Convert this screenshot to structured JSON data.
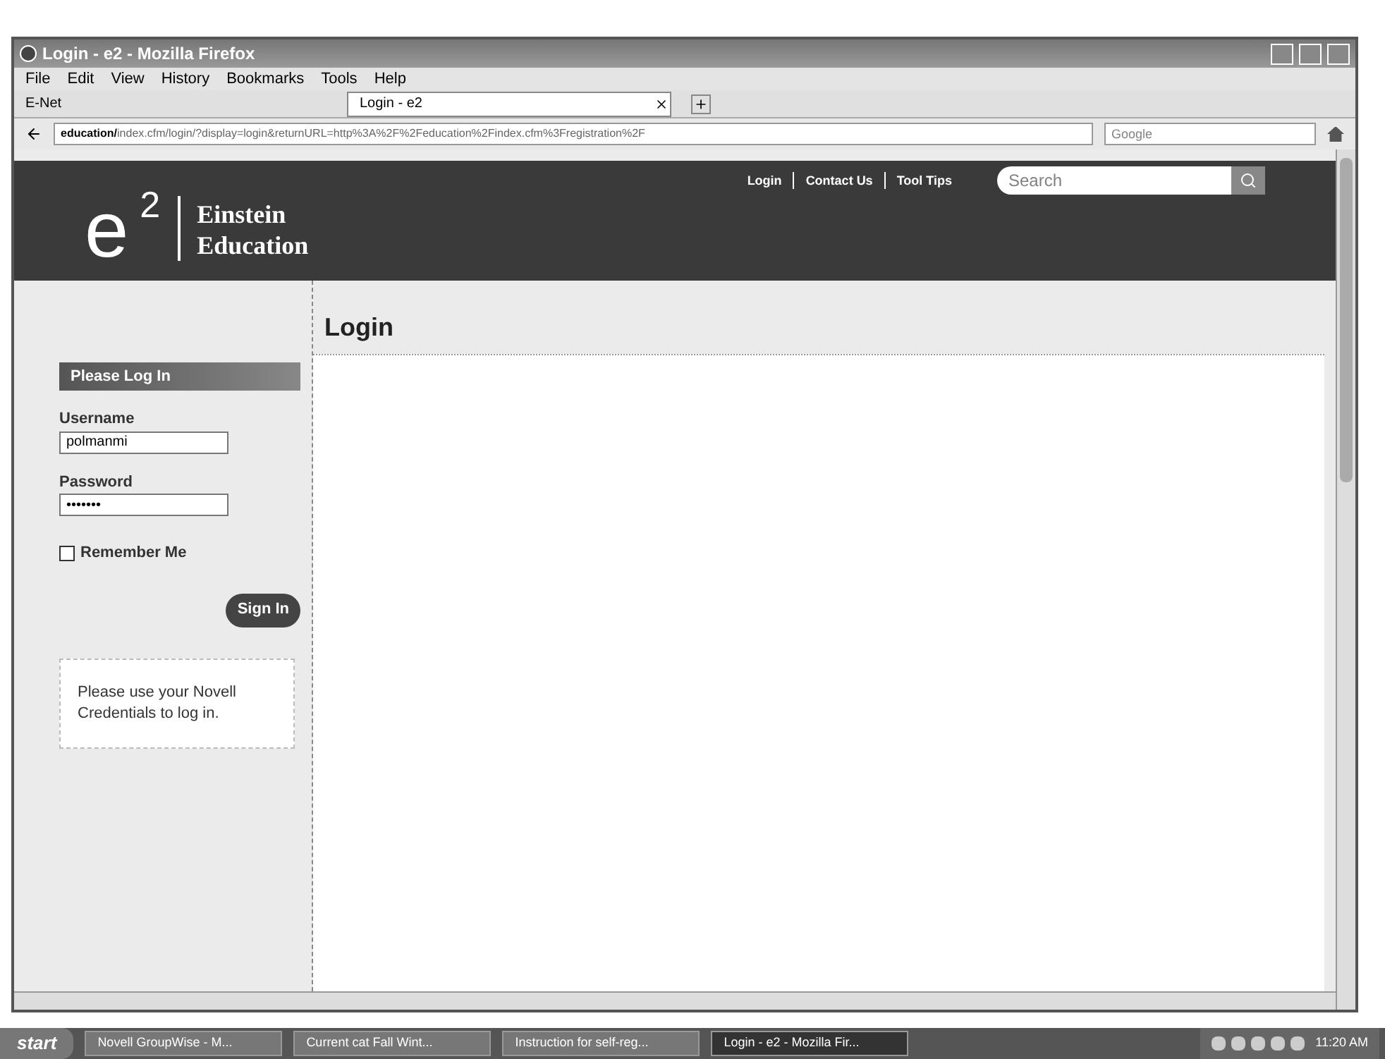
{
  "window": {
    "title": "Login - e2 - Mozilla Firefox"
  },
  "menu": [
    "File",
    "Edit",
    "View",
    "History",
    "Bookmarks",
    "Tools",
    "Help"
  ],
  "bookmarks": [
    "E-Net"
  ],
  "tabs": [
    {
      "label": "Login - e2",
      "selected": true
    }
  ],
  "address": {
    "host": "education/",
    "path": "index.cfm/login/?display=login&returnURL=http%3A%2F%2Feducation%2Findex.cfm%3Fregistration%2F"
  },
  "browser_search": {
    "placeholder": "Google"
  },
  "site": {
    "logo_letter": "e",
    "logo_power": "2",
    "name_lines": [
      "Einstein",
      "Education"
    ],
    "nav": [
      "Login",
      "Contact Us",
      "Tool Tips"
    ],
    "search": {
      "placeholder": "Search"
    }
  },
  "page_title": "Login",
  "login_box": {
    "title": "Please Log In",
    "username_label": "Username",
    "username": "polmanmi",
    "password_label": "Password",
    "password": "•••••••",
    "remember": {
      "label": "Remember Me",
      "checked": false
    },
    "button": "Sign In"
  },
  "note": "Please use your Novell Credentials to log in.",
  "taskbar": {
    "start": "start",
    "items": [
      {
        "label": "Novell GroupWise - M...",
        "selected": false
      },
      {
        "label": "Current cat Fall Wint...",
        "selected": false
      },
      {
        "label": "Instruction for self-reg...",
        "selected": false
      },
      {
        "label": "Login - e2 - Mozilla Fir...",
        "selected": true
      }
    ],
    "clock": "11:20 AM"
  }
}
